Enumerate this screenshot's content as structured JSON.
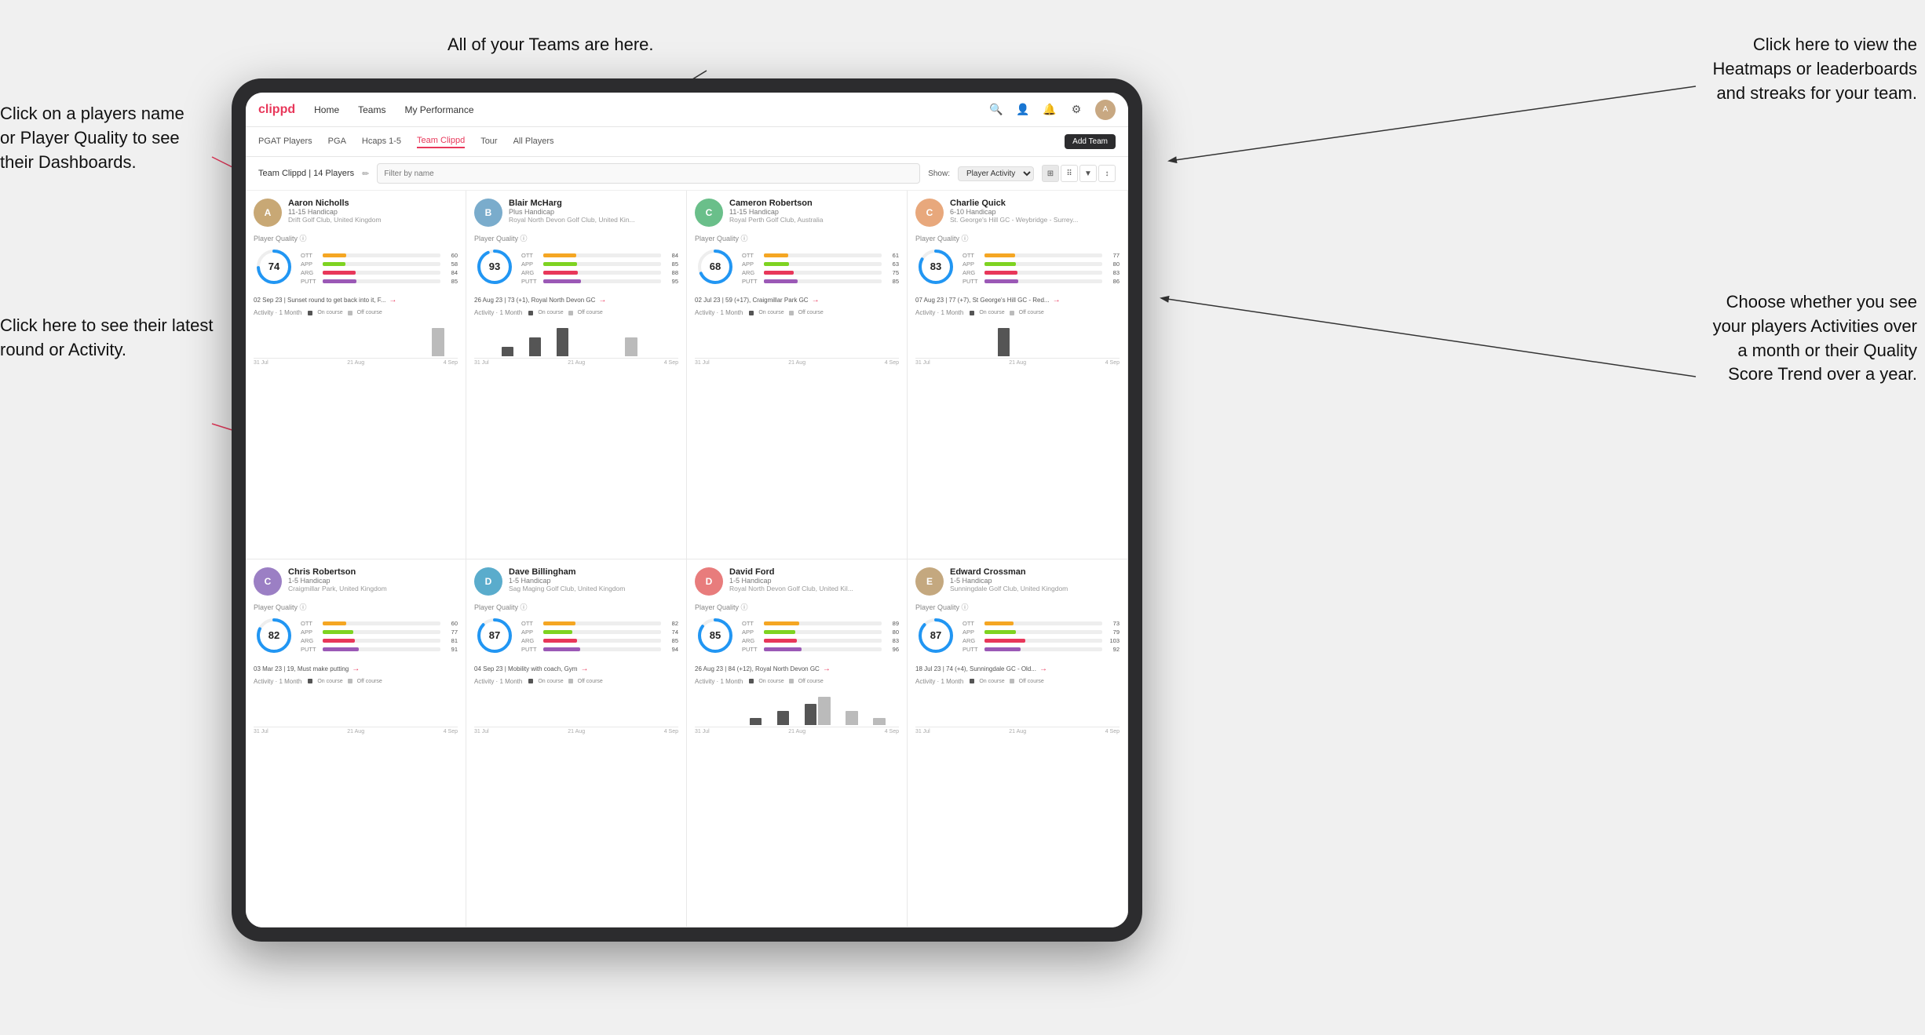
{
  "app": {
    "logo": "clippd",
    "nav_items": [
      "Home",
      "Teams",
      "My Performance"
    ],
    "tabs": [
      "PGAT Players",
      "PGA",
      "Hcaps 1-5",
      "Team Clippd",
      "Tour",
      "All Players"
    ],
    "active_tab": "Team Clippd",
    "add_team_label": "Add Team",
    "team_label": "Team Clippd | 14 Players",
    "search_placeholder": "Filter by name",
    "show_label": "Show:",
    "show_value": "Player Activity",
    "view_options": [
      "grid",
      "dots",
      "filter",
      "sort"
    ]
  },
  "annotations": {
    "click_name": "Click on a players name\nor Player Quality to see\ntheir Dashboards.",
    "click_round": "Click here to see their latest\nround or Activity.",
    "teams_here": "All of your Teams are here.",
    "heatmaps": "Click here to view the\nHeatmaps or leaderboards\nand streaks for your team.",
    "activities": "Choose whether you see\nyour players Activities over\na month or their Quality\nScore Trend over a year."
  },
  "players": [
    {
      "name": "Aaron Nicholls",
      "handicap": "11-15 Handicap",
      "club": "Drift Golf Club, United Kingdom",
      "quality": 74,
      "ott": 60,
      "app": 58,
      "arg": 84,
      "putt": 85,
      "last_round": "02 Sep 23 | Sunset round to get back into it, F...",
      "avatar_color": "#c8a875",
      "activity_bars": [
        0,
        0,
        0,
        0,
        0,
        0,
        0,
        0,
        0,
        0,
        0,
        0,
        0,
        1,
        0
      ],
      "chart_dates": [
        "31 Jul",
        "21 Aug",
        "4 Sep"
      ]
    },
    {
      "name": "Blair McHarg",
      "handicap": "Plus Handicap",
      "club": "Royal North Devon Golf Club, United Kin...",
      "quality": 93,
      "ott": 84,
      "app": 85,
      "arg": 88,
      "putt": 95,
      "last_round": "26 Aug 23 | 73 (+1), Royal North Devon GC",
      "avatar_color": "#7aaccc",
      "activity_bars": [
        0,
        0,
        1,
        0,
        2,
        0,
        3,
        0,
        0,
        0,
        0,
        2,
        0,
        0,
        0
      ],
      "chart_dates": [
        "31 Jul",
        "21 Aug",
        "4 Sep"
      ]
    },
    {
      "name": "Cameron Robertson",
      "handicap": "11-15 Handicap",
      "club": "Royal Perth Golf Club, Australia",
      "quality": 68,
      "ott": 61,
      "app": 63,
      "arg": 75,
      "putt": 85,
      "last_round": "02 Jul 23 | 59 (+17), Craigmillar Park GC",
      "avatar_color": "#6abf8a",
      "activity_bars": [
        0,
        0,
        0,
        0,
        0,
        0,
        0,
        0,
        0,
        0,
        0,
        0,
        0,
        0,
        0
      ],
      "chart_dates": [
        "31 Jul",
        "21 Aug",
        "4 Sep"
      ]
    },
    {
      "name": "Charlie Quick",
      "handicap": "6-10 Handicap",
      "club": "St. George's Hill GC - Weybridge - Surrey...",
      "quality": 83,
      "ott": 77,
      "app": 80,
      "arg": 83,
      "putt": 86,
      "last_round": "07 Aug 23 | 77 (+7), St George's Hill GC - Red...",
      "avatar_color": "#e8a87c",
      "activity_bars": [
        0,
        0,
        0,
        0,
        0,
        0,
        1,
        0,
        0,
        0,
        0,
        0,
        0,
        0,
        0
      ],
      "chart_dates": [
        "31 Jul",
        "21 Aug",
        "4 Sep"
      ]
    },
    {
      "name": "Chris Robertson",
      "handicap": "1-5 Handicap",
      "club": "Craigmillar Park, United Kingdom",
      "quality": 82,
      "ott": 60,
      "app": 77,
      "arg": 81,
      "putt": 91,
      "last_round": "03 Mar 23 | 19, Must make putting",
      "avatar_color": "#9b7fc4",
      "activity_bars": [
        0,
        0,
        0,
        0,
        0,
        0,
        0,
        0,
        0,
        0,
        0,
        0,
        0,
        0,
        0
      ],
      "chart_dates": [
        "31 Jul",
        "21 Aug",
        "4 Sep"
      ]
    },
    {
      "name": "Dave Billingham",
      "handicap": "1-5 Handicap",
      "club": "Sag Maging Golf Club, United Kingdom",
      "quality": 87,
      "ott": 82,
      "app": 74,
      "arg": 85,
      "putt": 94,
      "last_round": "04 Sep 23 | Mobility with coach, Gym",
      "avatar_color": "#5aaccc",
      "activity_bars": [
        0,
        0,
        0,
        0,
        0,
        0,
        0,
        0,
        0,
        0,
        0,
        0,
        0,
        0,
        0
      ],
      "chart_dates": [
        "31 Jul",
        "21 Aug",
        "4 Sep"
      ]
    },
    {
      "name": "David Ford",
      "handicap": "1-5 Handicap",
      "club": "Royal North Devon Golf Club, United Kil...",
      "quality": 85,
      "ott": 89,
      "app": 80,
      "arg": 83,
      "putt": 96,
      "last_round": "26 Aug 23 | 84 (+12), Royal North Devon GC",
      "avatar_color": "#e87c7c",
      "activity_bars": [
        0,
        0,
        0,
        0,
        1,
        0,
        2,
        0,
        3,
        4,
        0,
        2,
        0,
        1,
        0
      ],
      "chart_dates": [
        "31 Jul",
        "21 Aug",
        "4 Sep"
      ]
    },
    {
      "name": "Edward Crossman",
      "handicap": "1-5 Handicap",
      "club": "Sunningdale Golf Club, United Kingdom",
      "quality": 87,
      "ott": 73,
      "app": 79,
      "arg": 103,
      "putt": 92,
      "last_round": "18 Jul 23 | 74 (+4), Sunningdale GC - Old...",
      "avatar_color": "#c4a87f",
      "activity_bars": [
        0,
        0,
        0,
        0,
        0,
        0,
        0,
        0,
        0,
        0,
        0,
        0,
        0,
        0,
        0
      ],
      "chart_dates": [
        "31 Jul",
        "21 Aug",
        "4 Sep"
      ]
    }
  ],
  "bar_colors": {
    "ott": "#f5a623",
    "app": "#7ed321",
    "arg": "#e8375a",
    "putt": "#9b59b6"
  },
  "activity_colors": {
    "on_course": "#555",
    "off_course": "#aaa"
  }
}
